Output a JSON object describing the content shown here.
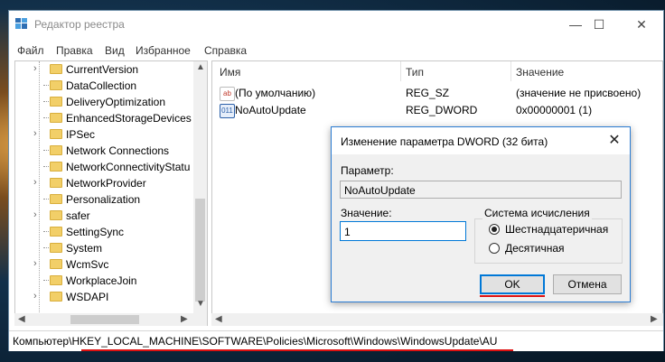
{
  "window": {
    "title": "Редактор реестра"
  },
  "window_controls": {
    "minimize": "—",
    "maximize": "☐",
    "close": "✕"
  },
  "menu": [
    "Файл",
    "Правка",
    "Вид",
    "Избранное",
    "Справка"
  ],
  "tree": {
    "items": [
      {
        "label": "CurrentVersion",
        "expandable": true
      },
      {
        "label": "DataCollection",
        "expandable": false
      },
      {
        "label": "DeliveryOptimization",
        "expandable": false
      },
      {
        "label": "EnhancedStorageDevices",
        "expandable": false
      },
      {
        "label": "IPSec",
        "expandable": true
      },
      {
        "label": "Network Connections",
        "expandable": false
      },
      {
        "label": "NetworkConnectivityStatu",
        "expandable": false
      },
      {
        "label": "NetworkProvider",
        "expandable": true
      },
      {
        "label": "Personalization",
        "expandable": false
      },
      {
        "label": "safer",
        "expandable": true
      },
      {
        "label": "SettingSync",
        "expandable": false
      },
      {
        "label": "System",
        "expandable": false
      },
      {
        "label": "WcmSvc",
        "expandable": true
      },
      {
        "label": "WorkplaceJoin",
        "expandable": false
      },
      {
        "label": "WSDAPI",
        "expandable": true
      }
    ]
  },
  "list": {
    "columns": [
      "Имя",
      "Тип",
      "Значение"
    ],
    "rows": [
      {
        "icon": "string-value-icon",
        "name": "(По умолчанию)",
        "type": "REG_SZ",
        "value": "(значение не присвоено)"
      },
      {
        "icon": "binary-value-icon",
        "name": "NoAutoUpdate",
        "type": "REG_DWORD",
        "value": "0x00000001 (1)"
      }
    ]
  },
  "statusbar": {
    "prefix": "Компьютер\\",
    "path": "HKEY_LOCAL_MACHINE\\SOFTWARE\\Policies\\Microsoft\\Windows\\WindowsUpdate\\AU"
  },
  "dialog": {
    "title": "Изменение параметра DWORD (32 бита)",
    "param_label": "Параметр:",
    "param_value": "NoAutoUpdate",
    "value_label": "Значение:",
    "value_input": "1",
    "base_legend": "Система исчисления",
    "base_options": [
      {
        "label": "Шестнадцатеричная",
        "checked": true
      },
      {
        "label": "Десятичная",
        "checked": false
      }
    ],
    "ok_label": "OK",
    "cancel_label": "Отмена"
  },
  "colors": {
    "accent": "#0078d7",
    "highlight": "#dd1111",
    "folder": "#f2cf68"
  }
}
